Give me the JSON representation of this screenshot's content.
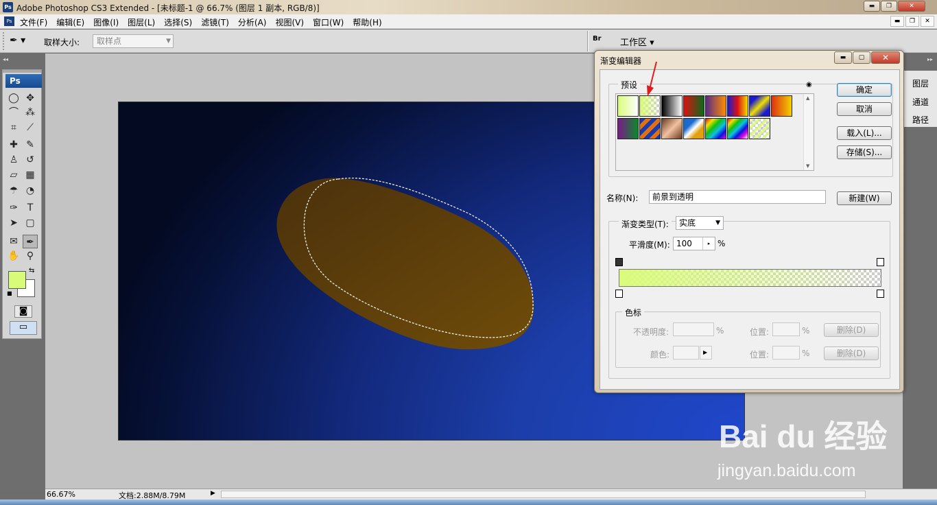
{
  "app": {
    "title": "Adobe Photoshop CS3 Extended - [未标题-1 @ 66.7% (图层 1 副本, RGB/8)]",
    "ps_badge": "Ps"
  },
  "menu": [
    "文件(F)",
    "编辑(E)",
    "图像(I)",
    "图层(L)",
    "选择(S)",
    "滤镜(T)",
    "分析(A)",
    "视图(V)",
    "窗口(W)",
    "帮助(H)"
  ],
  "options": {
    "sample_size_label": "取样大小:",
    "sample_size_value": "取样点",
    "workspace_label": "工作区 ▾",
    "bridge_label": "Br"
  },
  "toolbox": {
    "logo": "Ps",
    "foreground_color": "#d9fb7a",
    "background_color": "#ffffff"
  },
  "right_panels": [
    "图层",
    "通道",
    "路径"
  ],
  "status": {
    "zoom": "66.67%",
    "doc": "文档:2.88M/8.79M"
  },
  "dialog": {
    "title": "渐变编辑器",
    "presets_label": "预设",
    "ok": "确定",
    "cancel": "取消",
    "load": "载入(L)...",
    "save": "存储(S)...",
    "name_label": "名称(N):",
    "name_value": "前景到透明",
    "new_button": "新建(W)",
    "gradient_type_label": "渐变类型(T):",
    "gradient_type_value": "实底",
    "smoothness_label": "平滑度(M):",
    "smoothness_value": "100",
    "percent": "%",
    "stops_label": "色标",
    "opacity_label": "不透明度:",
    "location_label": "位置:",
    "delete_button": "删除(D)",
    "color_label": "颜色:"
  },
  "colors": {
    "document_bg": "#1c3ea9",
    "selection_fill": "#6b4a0c",
    "gradient_start": "#d9fb7a"
  },
  "watermark": {
    "logo": "Bai du 经验",
    "url": "jingyan.baidu.com"
  }
}
